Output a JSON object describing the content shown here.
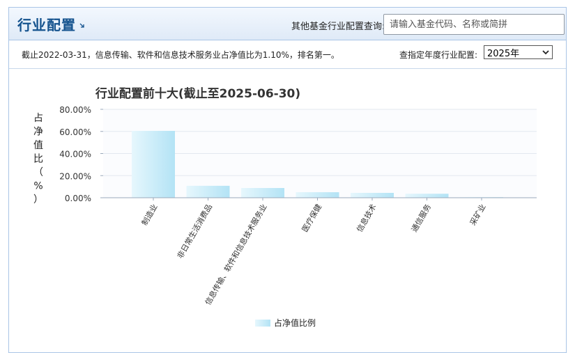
{
  "header": {
    "title": "行业配置",
    "search_label": "其他基金行业配置查询:",
    "search_placeholder": "请输入基金代码、名称或简拼"
  },
  "info": {
    "prefix": "截止",
    "date": "2022-03-31",
    "mid": "，信息传输、软件和信息技术服务业占净值比为",
    "pct": "1.10%",
    "suffix": "，排名第一。",
    "year_label": "查指定年度行业配置:",
    "year_value": "2025年"
  },
  "colors": {
    "bar_top": "#e6f7fd",
    "bar_bottom": "#b3e3f5",
    "title": "#15538e"
  },
  "chart_data": {
    "type": "bar",
    "title": "行业配置前十大(截止至2025-06-30)",
    "ylabel": "占净值比（%）",
    "ylim": [
      0,
      80
    ],
    "yticks": [
      "0.00%",
      "20.00%",
      "40.00%",
      "60.00%",
      "80.00%"
    ],
    "categories": [
      "制造业",
      "非日常生活消费品",
      "信息传输、软件和信息技术服务业",
      "医疗保健",
      "信息技术",
      "通信服务",
      "采矿业"
    ],
    "series": [
      {
        "name": "占净值比例",
        "values": [
          60.5,
          10.8,
          8.8,
          5.0,
          4.4,
          3.6,
          0.5
        ]
      }
    ],
    "legend": "bottom",
    "grid": true
  }
}
